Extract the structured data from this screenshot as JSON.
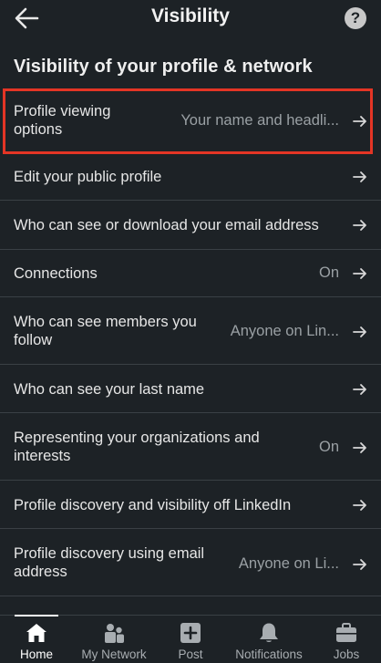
{
  "header": {
    "title": "Visibility",
    "back_icon": "arrow-left-icon",
    "help_icon": "question-icon",
    "help_glyph": "?"
  },
  "section": {
    "title": "Visibility of your profile & network"
  },
  "rows": [
    {
      "label": "Profile viewing options",
      "value": "Your name and headli...",
      "highlighted": true
    },
    {
      "label": "Edit your public profile",
      "value": ""
    },
    {
      "label": "Who can see or download your email address",
      "value": ""
    },
    {
      "label": "Connections",
      "value": "On"
    },
    {
      "label": "Who can see members you follow",
      "value": "Anyone on Lin..."
    },
    {
      "label": "Who can see your last name",
      "value": ""
    },
    {
      "label": "Representing your organizations and interests",
      "value": "On"
    },
    {
      "label": "Profile discovery and visibility off LinkedIn",
      "value": ""
    },
    {
      "label": "Profile discovery using email address",
      "value": "Anyone on Li..."
    }
  ],
  "nav": [
    {
      "label": "Home",
      "icon": "home-icon",
      "active": true
    },
    {
      "label": "My Network",
      "icon": "people-icon",
      "active": false
    },
    {
      "label": "Post",
      "icon": "plus-square-icon",
      "active": false
    },
    {
      "label": "Notifications",
      "icon": "bell-icon",
      "active": false
    },
    {
      "label": "Jobs",
      "icon": "briefcase-icon",
      "active": false
    }
  ],
  "colors": {
    "background": "#1d2226",
    "highlight": "#e43525",
    "secondary_text": "#9aa0a4"
  }
}
